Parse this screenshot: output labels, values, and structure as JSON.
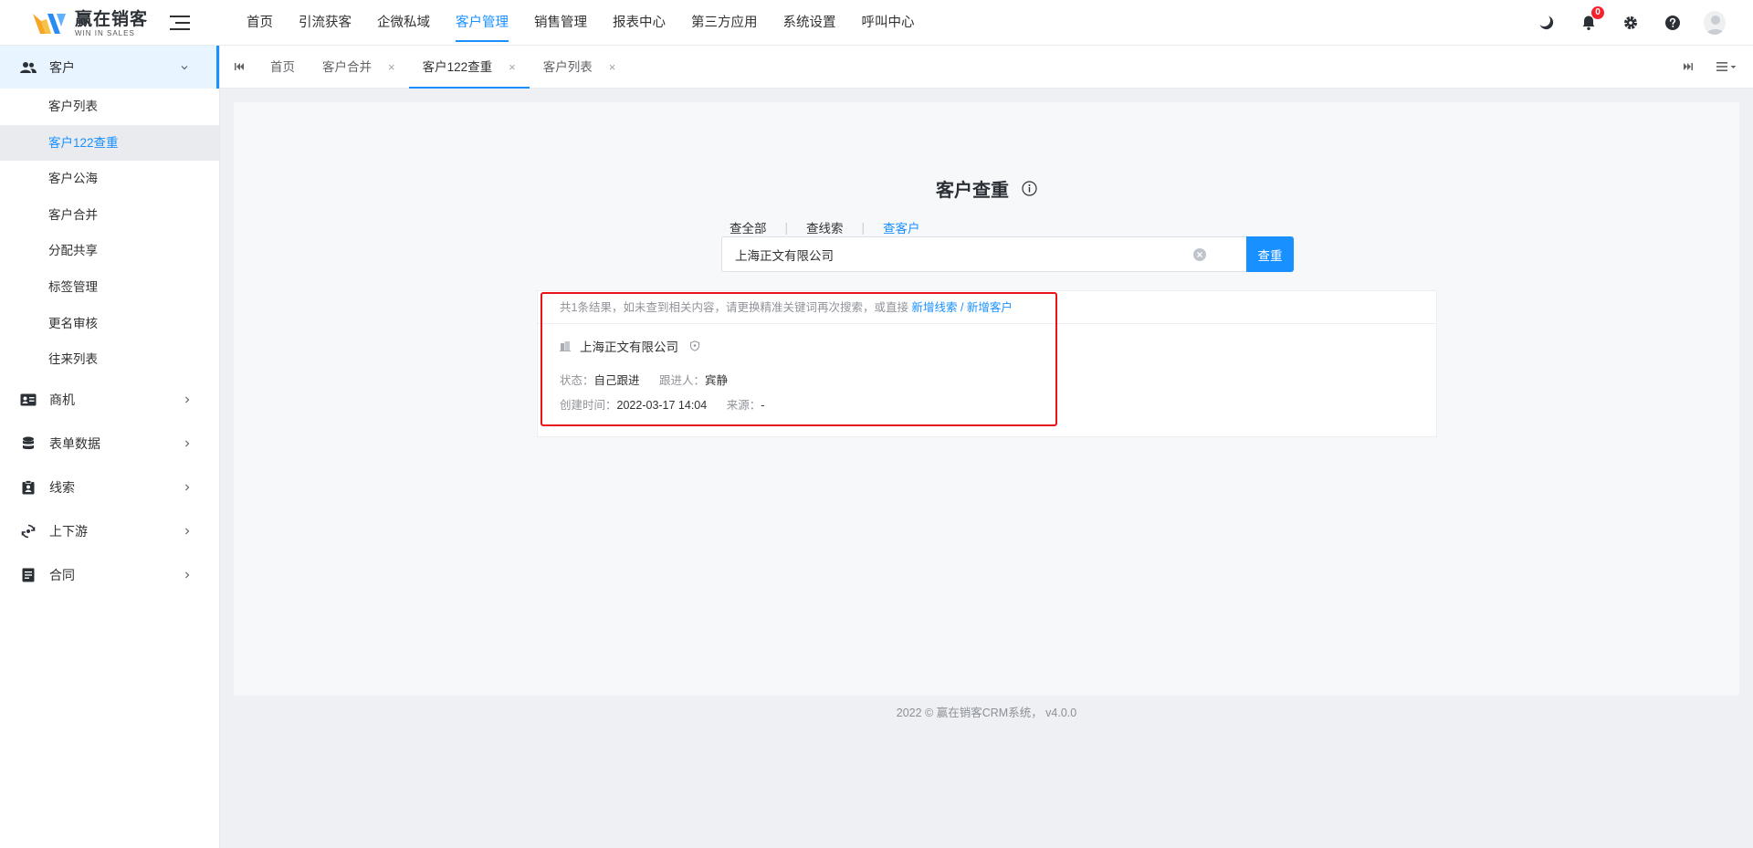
{
  "brand": {
    "name_cn": "赢在销客",
    "name_en": "WIN IN SALES"
  },
  "topnav": [
    {
      "label": "首页",
      "active": false
    },
    {
      "label": "引流获客",
      "active": false
    },
    {
      "label": "企微私域",
      "active": false
    },
    {
      "label": "客户管理",
      "active": true
    },
    {
      "label": "销售管理",
      "active": false
    },
    {
      "label": "报表中心",
      "active": false
    },
    {
      "label": "第三方应用",
      "active": false
    },
    {
      "label": "系统设置",
      "active": false
    },
    {
      "label": "呼叫中心",
      "active": false
    }
  ],
  "header_icons": {
    "notification_count": "0",
    "icons": [
      "moon-icon",
      "bell-icon",
      "gear-icon",
      "help-icon",
      "avatar"
    ]
  },
  "sidebar": {
    "customer_group": {
      "label": "客户",
      "items": [
        {
          "label": "客户列表"
        },
        {
          "label": "客户122查重",
          "active": true
        },
        {
          "label": "客户公海"
        },
        {
          "label": "客户合并"
        },
        {
          "label": "分配共享"
        },
        {
          "label": "标签管理"
        },
        {
          "label": "更名审核"
        },
        {
          "label": "往来列表"
        }
      ]
    },
    "groups": [
      {
        "label": "商机",
        "icon": "id-card-icon"
      },
      {
        "label": "表单数据",
        "icon": "database-icon"
      },
      {
        "label": "线索",
        "icon": "clipboard-icon"
      },
      {
        "label": "上下游",
        "icon": "refresh-icon"
      },
      {
        "label": "合同",
        "icon": "document-icon"
      }
    ]
  },
  "tabs": [
    {
      "label": "首页",
      "closable": false
    },
    {
      "label": "客户合并",
      "closable": true
    },
    {
      "label": "客户122查重",
      "closable": true,
      "active": true
    },
    {
      "label": "客户列表",
      "closable": true
    }
  ],
  "main": {
    "title": "客户查重",
    "modes": [
      {
        "label": "查全部",
        "active": false
      },
      {
        "label": "查线索",
        "active": false
      },
      {
        "label": "查客户",
        "active": true
      }
    ],
    "search": {
      "value": "上海正文有限公司",
      "button_label": "查重"
    },
    "results": {
      "summary_prefix": "共1条结果，如未查到相关内容，请更换精准关键词再次搜索，或直接",
      "link_new_lead": "新增线索",
      "separator": "/",
      "link_new_customer": "新增客户",
      "items": [
        {
          "company": "上海正文有限公司",
          "status_label": "状态：",
          "status_value": "自己跟进",
          "owner_label": "跟进人：",
          "owner_value": "宾静",
          "created_label": "创建时间：",
          "created_value": "2022-03-17 14:04",
          "source_label": "来源：",
          "source_value": "-"
        }
      ]
    }
  },
  "footer": "2022 © 赢在销客CRM系统， v4.0.0",
  "colors": {
    "accent": "#1890ff",
    "highlight_border": "#e8141a",
    "badge": "#f5222d"
  }
}
